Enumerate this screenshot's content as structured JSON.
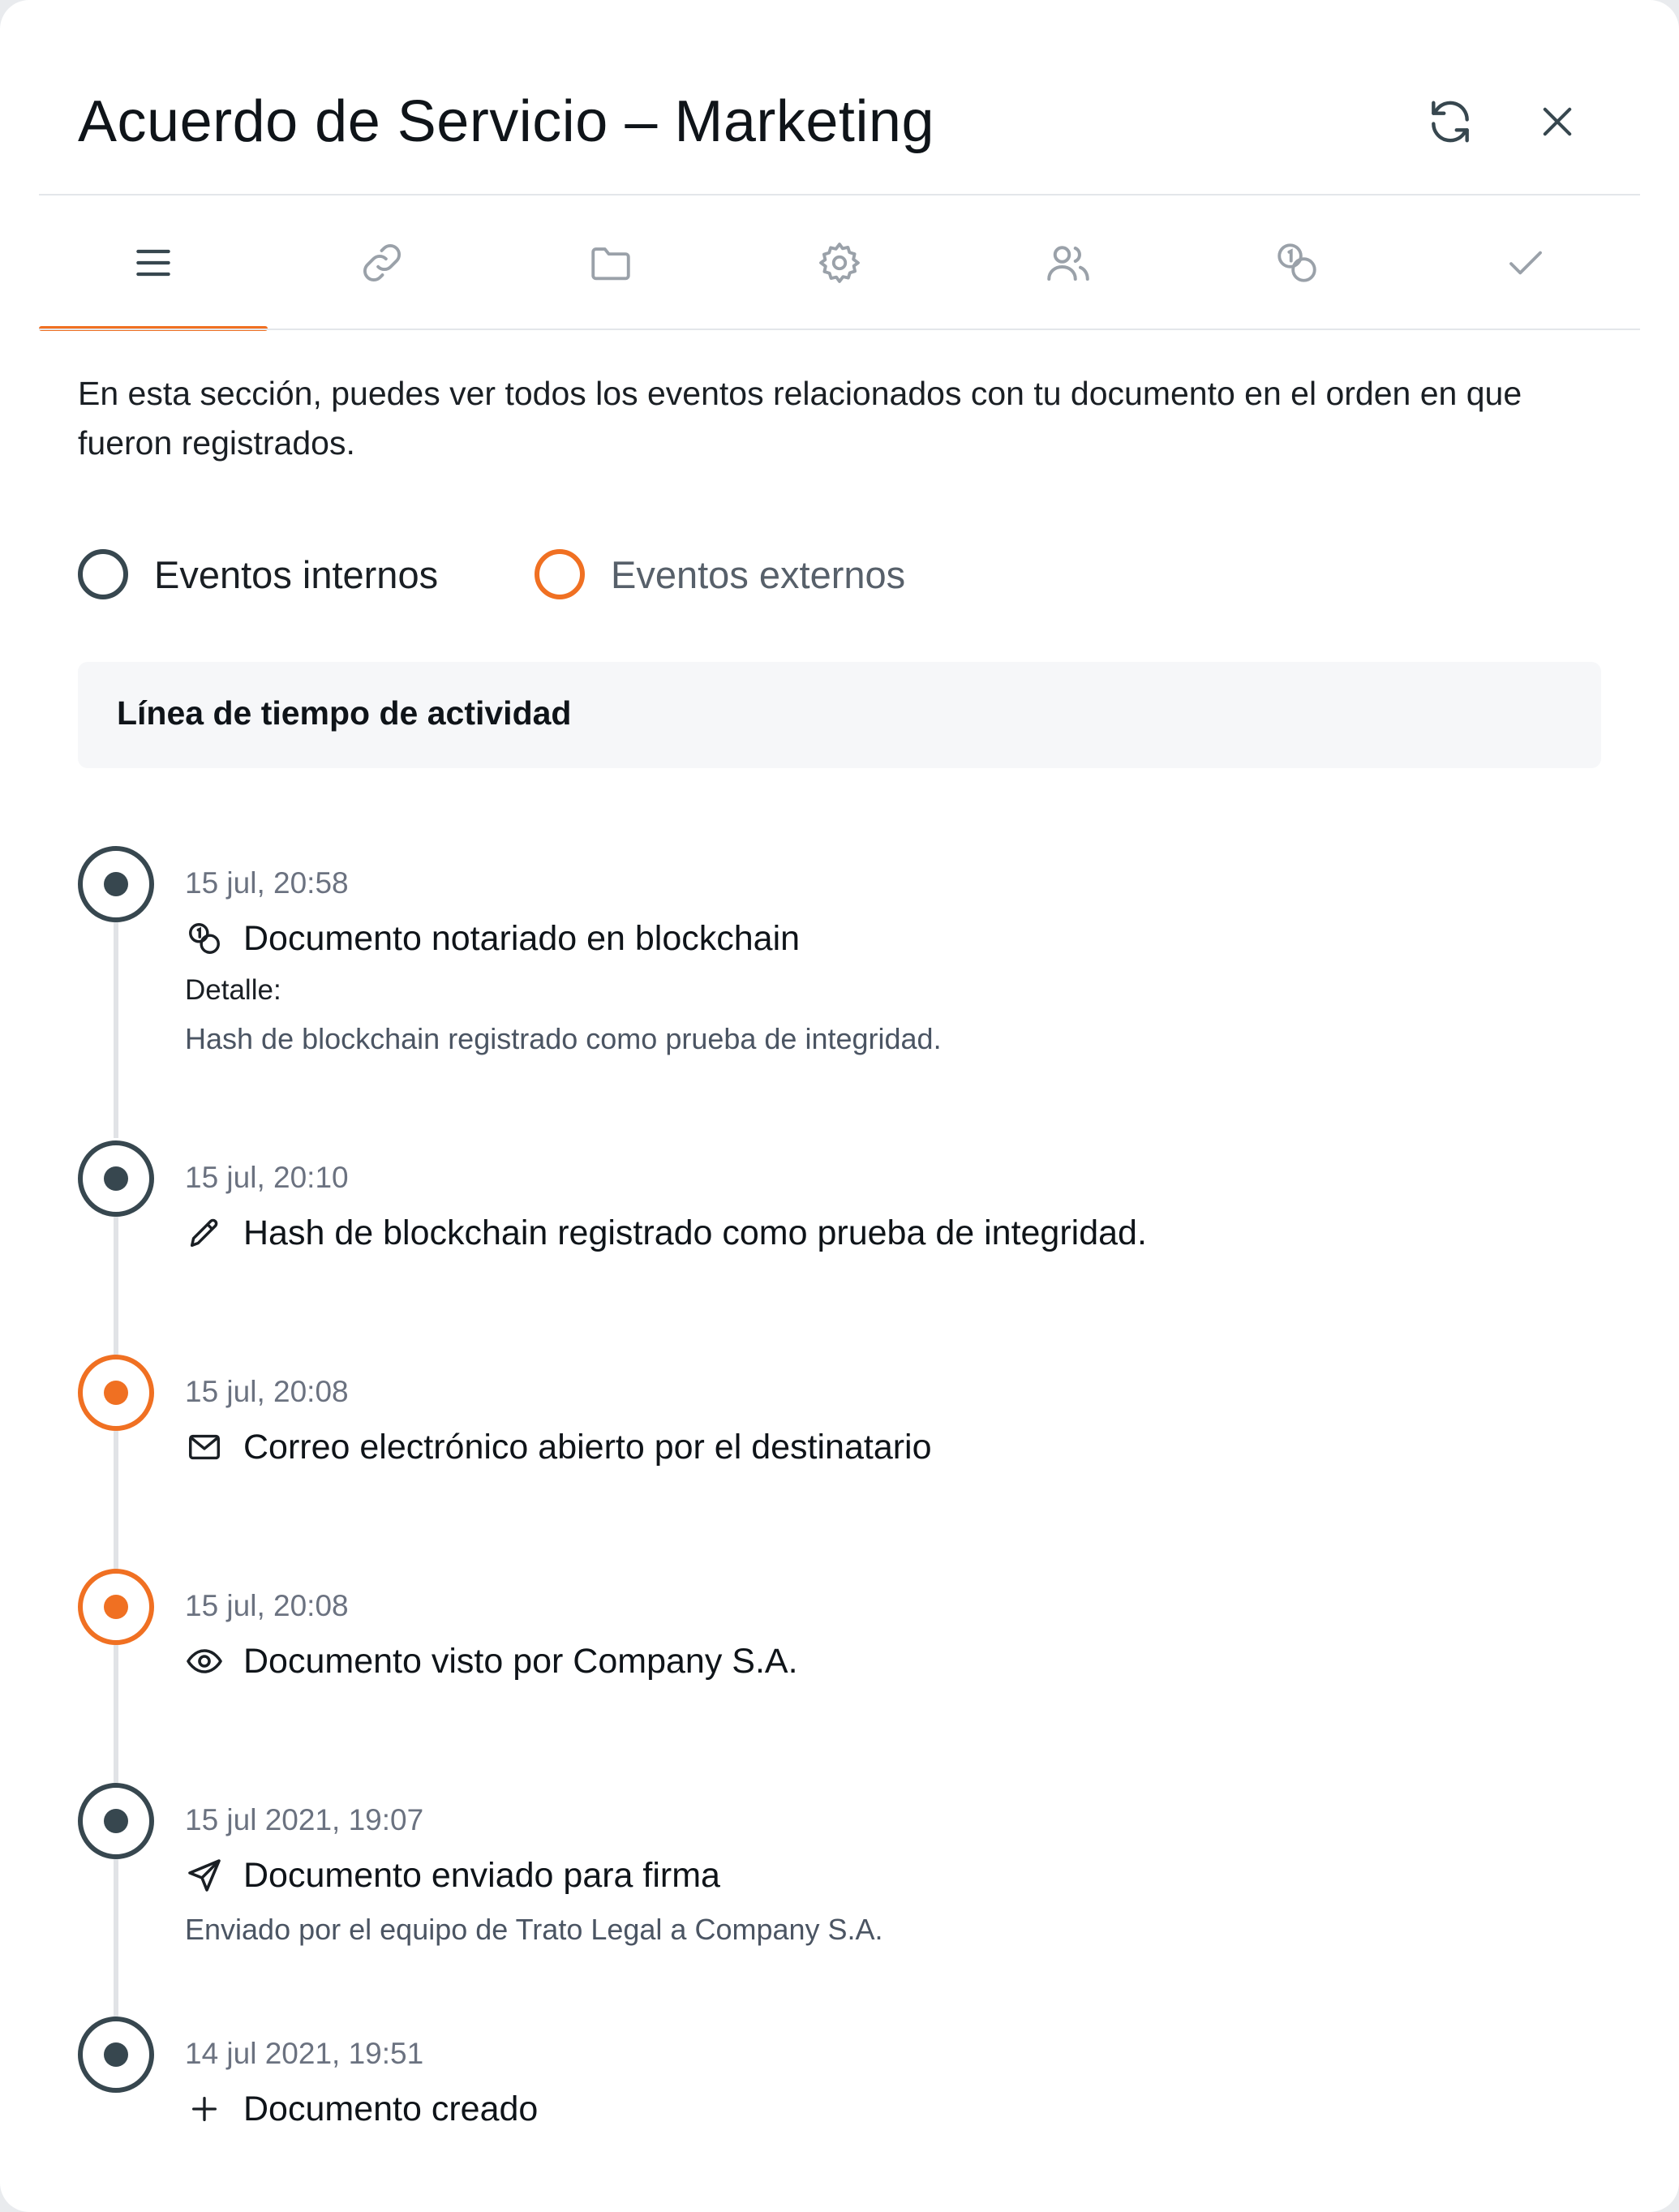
{
  "header": {
    "title": "Acuerdo de Servicio – Marketing",
    "refresh_icon": "refresh-icon",
    "close_icon": "close-icon"
  },
  "tabs": [
    {
      "icon": "list-icon",
      "active": true
    },
    {
      "icon": "link-icon",
      "active": false
    },
    {
      "icon": "folder-icon",
      "active": false
    },
    {
      "icon": "gear-icon",
      "active": false
    },
    {
      "icon": "users-icon",
      "active": false
    },
    {
      "icon": "coins-icon",
      "active": false
    },
    {
      "icon": "check-icon",
      "active": false
    }
  ],
  "description": "En esta sección, puedes ver todos los eventos relacionados con tu documento en el orden en que fueron registrados.",
  "filters": {
    "internal": {
      "label": "Eventos internos",
      "color": "#37474f"
    },
    "external": {
      "label": "Eventos externos",
      "color": "#f07022"
    }
  },
  "timeline": {
    "heading": "Línea de tiempo de actividad",
    "events": [
      {
        "time": "15 jul, 20:58",
        "icon": "blockchain-icon",
        "title": "Documento notariado en blockchain",
        "type": "internal",
        "detail_label": "Detalle:",
        "detail": "Hash de blockchain registrado como prueba de integridad."
      },
      {
        "time": "15 jul, 20:10",
        "icon": "pencil-icon",
        "title": "Hash de blockchain registrado como prueba de integridad.",
        "type": "internal"
      },
      {
        "time": "15 jul, 20:08",
        "icon": "mail-icon",
        "title": "Correo electrónico abierto por el destinatario",
        "type": "external"
      },
      {
        "time": "15 jul, 20:08",
        "icon": "eye-icon",
        "title": "Documento visto por Company S.A.",
        "type": "external"
      },
      {
        "time": "15 jul 2021, 19:07",
        "icon": "send-icon",
        "title": "Documento enviado para firma",
        "type": "internal",
        "detail": "Enviado por el equipo de Trato Legal a Company S.A."
      },
      {
        "time": "14 jul 2021, 19:51",
        "icon": "plus-icon",
        "title": "Documento creado",
        "type": "internal"
      }
    ]
  },
  "colors": {
    "accent": "#f07022",
    "internal": "#37474f",
    "icon": "#9aa1a9"
  }
}
